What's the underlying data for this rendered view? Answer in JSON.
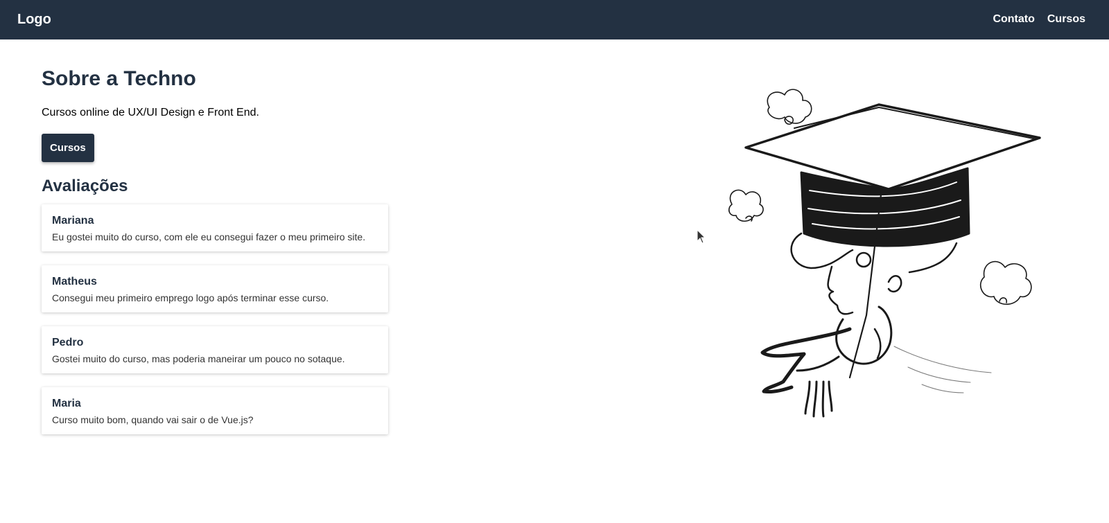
{
  "header": {
    "logo": "Logo",
    "nav": [
      {
        "label": "Contato"
      },
      {
        "label": "Cursos"
      }
    ]
  },
  "main": {
    "title": "Sobre a Techno",
    "description": "Cursos online de UX/UI Design e Front End.",
    "button_label": "Cursos",
    "reviews_title": "Avaliações",
    "reviews": [
      {
        "name": "Mariana",
        "text": "Eu gostei muito do curso, com ele eu consegui fazer o meu primeiro site."
      },
      {
        "name": "Matheus",
        "text": "Consegui meu primeiro emprego logo após terminar esse curso."
      },
      {
        "name": "Pedro",
        "text": "Gostei muito do curso, mas poderia maneirar um pouco no sotaque."
      },
      {
        "name": "Maria",
        "text": "Curso muito bom, quando vai sair o de Vue.js?"
      }
    ]
  },
  "illustration": {
    "icon": "graduation-cap-illustration"
  },
  "colors": {
    "primary": "#233142",
    "background": "#ffffff"
  }
}
